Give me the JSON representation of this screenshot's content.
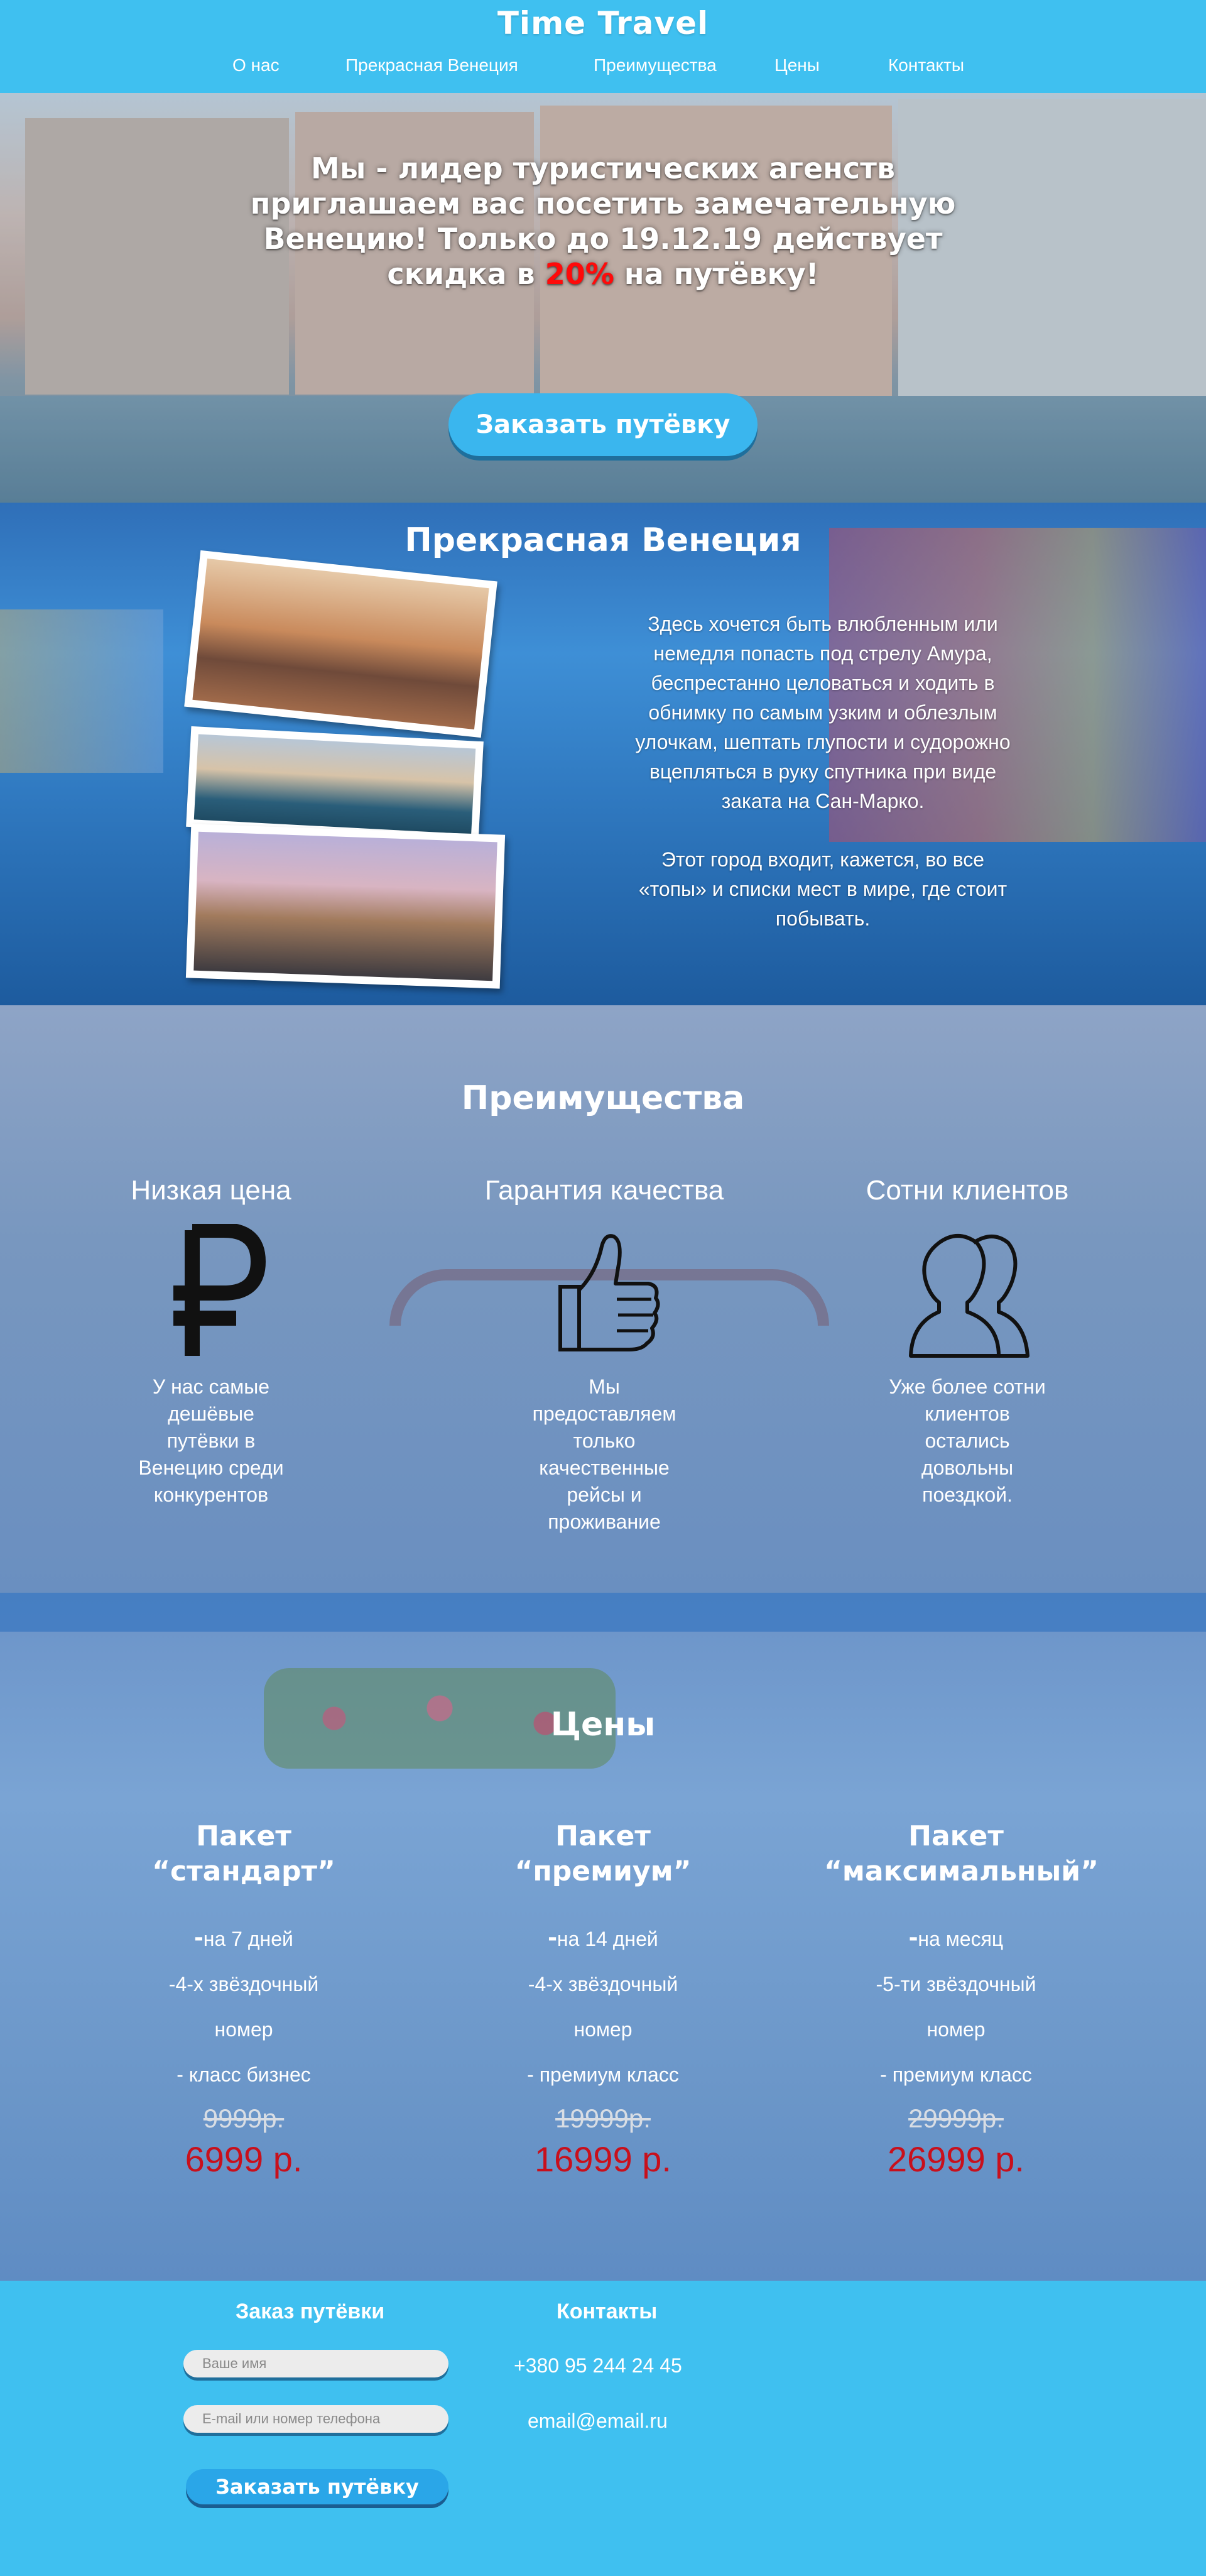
{
  "header": {
    "logo": "Time Travel",
    "nav": [
      "О нас",
      "Прекрасная Венеция",
      "Преимущества",
      "Цены",
      "Контакты"
    ]
  },
  "hero": {
    "line1": "Мы - лидер туристических агенств",
    "line2": "приглашаем вас посетить замечательную",
    "line3": "Венецию! Только до 19.12.19 действует",
    "line4_before": "скидка в ",
    "discount": "20%",
    "line4_after": " на путёвку!",
    "button": "Заказать путёвку"
  },
  "venice": {
    "title": "Прекрасная Венеция",
    "paragraph1": "Здесь хочется быть влюбленным или немедля попасть под стрелу Амура, беспрестанно целоваться и ходить в обнимку по самым узким и облезлым улочкам, шептать глупости и судорожно вцепляться в руку спутника при виде заката на Сан-Марко.",
    "paragraph2": "Этот город входит, кажется, во все «топы» и списки мест в мире, где стоит побывать."
  },
  "advantages": {
    "title": "Преимущества",
    "items": [
      {
        "title": "Низкая цена",
        "icon": "ruble-icon",
        "desc": "У нас самые дешёвые путёвки в Венецию среди конкурентов"
      },
      {
        "title": "Гарантия качества",
        "icon": "thumbs-up-icon",
        "desc": "Мы предоставляем только качественные рейсы и проживание"
      },
      {
        "title": "Сотни клиентов",
        "icon": "users-icon",
        "desc": "Уже более сотни клиентов остались довольны поездкой."
      }
    ]
  },
  "prices": {
    "title": "Цены",
    "packages": [
      {
        "name1": "Пакет",
        "name2": "“стандарт”",
        "f1": "на 7 дней",
        "f2": "-4-х звёздочный",
        "f3": "номер",
        "f4": "- класс бизнес",
        "old": "9999р.",
        "new": "6999 р."
      },
      {
        "name1": "Пакет",
        "name2": "“премиум”",
        "f1": "на 14 дней",
        "f2": "-4-х звёздочный",
        "f3": "номер",
        "f4": "- премиум класс",
        "old": "19999р.",
        "new": "16999 р."
      },
      {
        "name1": "Пакет",
        "name2": "“максимальный”",
        "f1": "на месяц",
        "f2": "-5-ти звёздочный",
        "f3": "номер",
        "f4": "- премиум класс",
        "old": "29999р.",
        "new": "26999 р."
      }
    ]
  },
  "order": {
    "title": "Заказ путёвки",
    "name_placeholder": "Ваше имя",
    "contact_placeholder": "E-mail или номер телефона",
    "button": "Заказать путёвку"
  },
  "contacts": {
    "title": "Контакты",
    "phone": "+380 95 244 24 45",
    "email": "email@email.ru"
  },
  "colors": {
    "brand_blue": "#3fc0f0",
    "discount_red": "#ff0a0a",
    "price_red": "#c8101c"
  }
}
